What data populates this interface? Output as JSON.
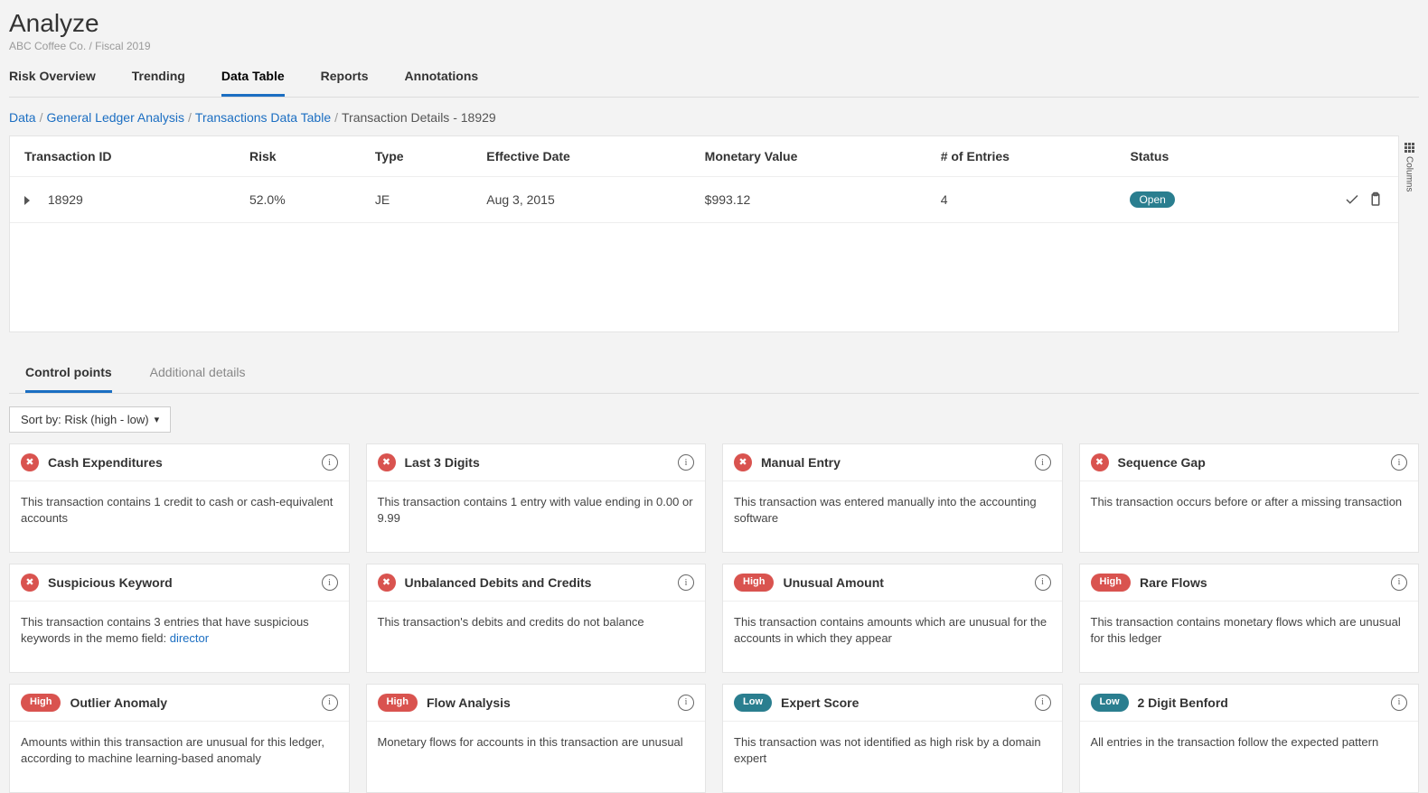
{
  "header": {
    "title": "Analyze",
    "subtitle": "ABC Coffee Co. / Fiscal 2019"
  },
  "tabs": [
    "Risk Overview",
    "Trending",
    "Data Table",
    "Reports",
    "Annotations"
  ],
  "tabs_active_index": 2,
  "breadcrumb": {
    "items": [
      "Data",
      "General Ledger Analysis",
      "Transactions Data Table"
    ],
    "current": "Transaction Details - 18929"
  },
  "columns_rail": "Columns",
  "table": {
    "headers": [
      "Transaction ID",
      "Risk",
      "Type",
      "Effective Date",
      "Monetary Value",
      "# of Entries",
      "Status"
    ],
    "row": {
      "id": "18929",
      "risk": "52.0%",
      "type": "JE",
      "effective_date": "Aug 3, 2015",
      "monetary_value": "$993.12",
      "entries": "4",
      "status": "Open"
    }
  },
  "section_tabs": {
    "items": [
      "Control points",
      "Additional details"
    ],
    "active_index": 0
  },
  "sort": {
    "label": "Sort by:",
    "value": "Risk (high - low)"
  },
  "cards": [
    {
      "badge": "x",
      "title": "Cash Expenditures",
      "body": "This transaction contains 1 credit to cash or cash-equivalent accounts"
    },
    {
      "badge": "x",
      "title": "Last 3 Digits",
      "body": "This transaction contains 1 entry with value ending in 0.00 or 9.99"
    },
    {
      "badge": "x",
      "title": "Manual Entry",
      "body": "This transaction was entered manually into the accounting software"
    },
    {
      "badge": "x",
      "title": "Sequence Gap",
      "body": "This transaction occurs before or after a missing transaction"
    },
    {
      "badge": "x",
      "title": "Suspicious Keyword",
      "body": "This transaction contains 3 entries that have suspicious keywords in the memo field: ",
      "link": "director"
    },
    {
      "badge": "x",
      "title": "Unbalanced Debits and Credits",
      "body": "This transaction's debits and credits do not balance"
    },
    {
      "badge": "high",
      "badge_label": "High",
      "title": "Unusual Amount",
      "body": "This transaction contains amounts which are unusual for the accounts in which they appear"
    },
    {
      "badge": "high",
      "badge_label": "High",
      "title": "Rare Flows",
      "body": "This transaction contains monetary flows which are unusual for this ledger"
    },
    {
      "badge": "high",
      "badge_label": "High",
      "title": "Outlier Anomaly",
      "body": "Amounts within this transaction are unusual for this ledger, according to machine learning-based anomaly"
    },
    {
      "badge": "high",
      "badge_label": "High",
      "title": "Flow Analysis",
      "body": "Monetary flows for accounts in this transaction are unusual"
    },
    {
      "badge": "low",
      "badge_label": "Low",
      "title": "Expert Score",
      "body": "This transaction was not identified as high risk by a domain expert"
    },
    {
      "badge": "low",
      "badge_label": "Low",
      "title": "2 Digit Benford",
      "body": "All entries in the transaction follow the expected pattern"
    }
  ]
}
